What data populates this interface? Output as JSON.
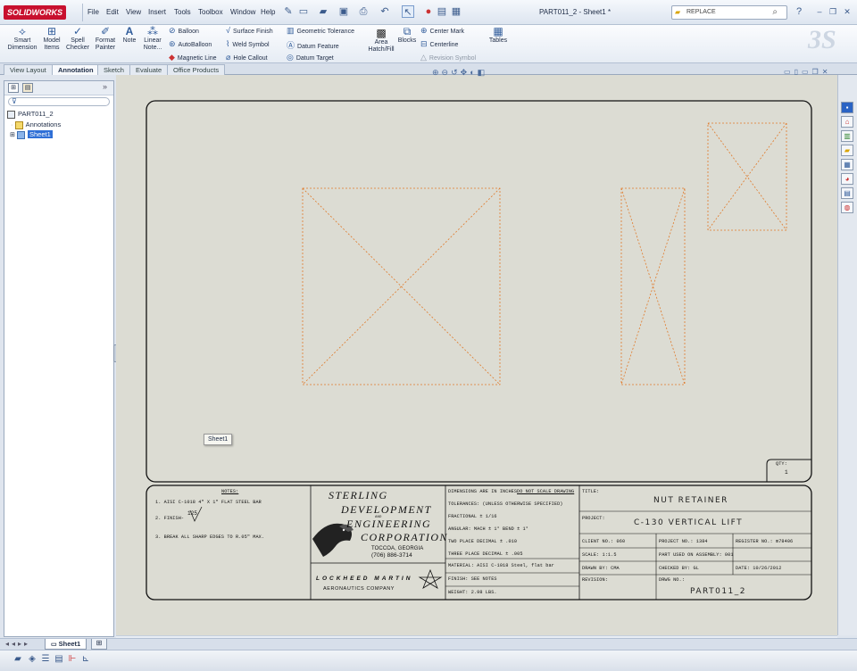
{
  "app": {
    "logo": "SOLIDWORKS",
    "menu": [
      "File",
      "Edit",
      "View",
      "Insert",
      "Tools",
      "Toolbox",
      "Window",
      "Help"
    ],
    "document_title": "PART011_2 - Sheet1 *",
    "search_placeholder": "REPLACE"
  },
  "command_manager": {
    "big_buttons": [
      {
        "label": "Smart Dimension",
        "icon": "smart-dimension-icon"
      },
      {
        "label": "Model Items",
        "icon": "model-items-icon"
      },
      {
        "label": "Spell Checker",
        "icon": "spell-checker-icon"
      },
      {
        "label": "Format Painter",
        "icon": "format-painter-icon"
      },
      {
        "label": "Note",
        "icon": "note-icon"
      },
      {
        "label": "Linear Note...",
        "icon": "linear-note-icon"
      }
    ],
    "col1": [
      "Balloon",
      "AutoBalloon",
      "Magnetic Line"
    ],
    "col2": [
      "Surface Finish",
      "Weld Symbol",
      "Hole Callout"
    ],
    "col3": [
      "Geometric Tolerance",
      "Datum Feature",
      "Datum Target"
    ],
    "area_hatch": "Area Hatch/Fill",
    "blocks": "Blocks",
    "col4": [
      "Center Mark",
      "Centerline",
      "Revision Symbol"
    ],
    "tables": "Tables"
  },
  "tabs": [
    "View Layout",
    "Annotation",
    "Sketch",
    "Evaluate",
    "Office Products"
  ],
  "active_tab": "Annotation",
  "tree": {
    "root": "PART011_2",
    "items": [
      "Annotations",
      "Sheet1"
    ]
  },
  "sheet_tooltip": "Sheet1",
  "sheet_tab": "Sheet1",
  "qty": {
    "label": "QTY:",
    "value": "1"
  },
  "title_block": {
    "notes_heading": "NOTES:",
    "notes": [
      "1. AISI C-1018 4\" X 1\" FLAT STEEL BAR",
      "2. FINISH-",
      "3. BREAK ALL SHARP EDGES TO R.05\" MAX."
    ],
    "finish_value": "125",
    "company_lines": [
      "STERLING",
      "DEVELOPMENT",
      "ENGINEERING",
      "CORPORATION"
    ],
    "company_and": "AND",
    "company_city": "TOCCOA, GEORGIA",
    "company_phone": "(706) 886-3714",
    "partner": "LOCKHEED MARTIN",
    "partner_sub": "AERONAUTICS COMPANY",
    "dimensions": "DIMENSIONS ARE IN INCHES",
    "do_not_scale": "DO NOT SCALE DRAWING",
    "tolerances": "TOLERANCES: (UNLESS OTHERWISE SPECIFIED)",
    "fractional": "FRACTIONAL ± 1/16",
    "angular": "ANGULAR:  MACH ± 1°    BEND ± 1°",
    "two_place": "TWO PLACE DECIMAL ± .010",
    "three_place": "THREE PLACE DECIMAL ± .005",
    "material": "MATERIAL:  AISI C-1018 Steel, flat bar",
    "finish": "FINISH:  SEE NOTES",
    "weight": "WEIGHT:  2.98 LBS.",
    "title_label": "TITLE:",
    "title_value": "NUT RETAINER",
    "project_label": "PROJECT:",
    "project_value": "C-130 VERTICAL LIFT",
    "client_no": "CLIENT NO.:  060",
    "project_no": "PROJECT NO.:  1384",
    "register_no": "REGISTER NO.:  m78406",
    "scale": "SCALE:  1:1.5",
    "part_used": "PART USED ON ASSEMBLY:  001",
    "drawn_by": "DRAWN BY:  CMA",
    "checked_by": "CHECKED BY:  GL",
    "date": "DATE:  10/26/2012",
    "revision": "REVISION:",
    "dwg_label": "DRWG NO.:",
    "dwg_value": "PART011_2"
  }
}
